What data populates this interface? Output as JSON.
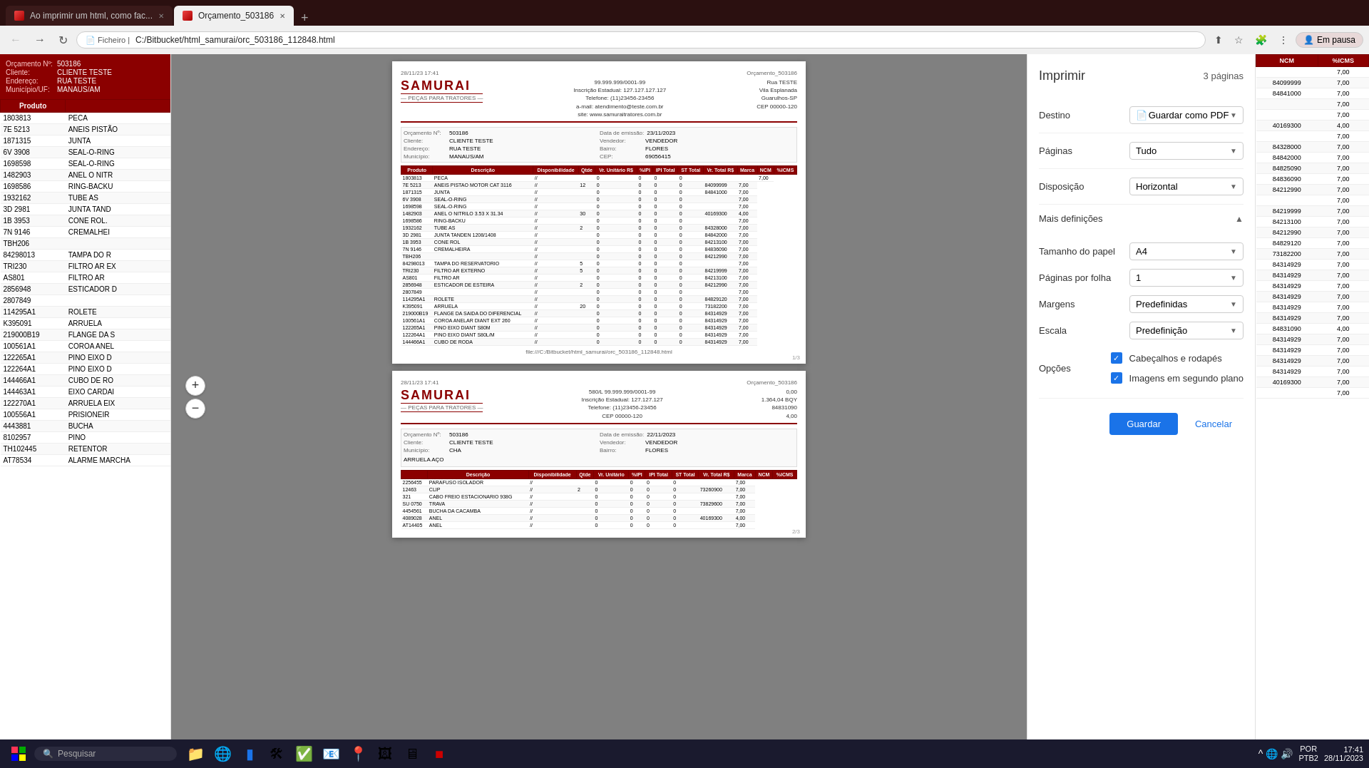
{
  "browser": {
    "tabs": [
      {
        "id": "tab1",
        "title": "Ao imprimir um html, como fac...",
        "active": false,
        "icon_color": "#e44"
      },
      {
        "id": "tab2",
        "title": "Orçamento_503186",
        "active": true,
        "icon_color": "#e44"
      }
    ],
    "address": {
      "protocol": "Ficheiro",
      "path": "C:/Bitbucket/html_samurai/orc_503186_112848.html"
    },
    "profile": "Em pausa"
  },
  "document": {
    "order_number": "503186",
    "client": "CLIENTE TESTE",
    "address": "RUA TESTE",
    "city": "MANAUS/AM",
    "labels": {
      "order": "Orçamento Nº:",
      "client": "Cliente:",
      "address": "Endereço:",
      "city": "Município/UF:"
    }
  },
  "left_table": {
    "headers": [
      "Produto",
      ""
    ],
    "rows": [
      [
        "1803813",
        "PECA"
      ],
      [
        "7E 5213",
        "ANEIS PISTÃO"
      ],
      [
        "1871315",
        "JUNTA"
      ],
      [
        "6V 3908",
        "SEAL-O-RING"
      ],
      [
        "1698598",
        "SEAL-O-RING"
      ],
      [
        "1482903",
        "ANEL O NITR"
      ],
      [
        "1698586",
        "RING-BACKU"
      ],
      [
        "1932162",
        "TUBE AS"
      ],
      [
        "3D 2981",
        "JUNTA TAND"
      ],
      [
        "1B 3953",
        "CONE ROL."
      ],
      [
        "7N 9146",
        "CREMALHEI"
      ],
      [
        "TBH206",
        ""
      ],
      [
        "84298013",
        "TAMPA DO R"
      ],
      [
        "TRI230",
        "FILTRO AR EX"
      ],
      [
        "AS801",
        "FILTRO AR"
      ],
      [
        "2856948",
        "ESTICADOR D"
      ],
      [
        "2807849",
        ""
      ],
      [
        "114295A1",
        "ROLETE"
      ],
      [
        "K395091",
        "ARRUELA"
      ],
      [
        "219000B19",
        "FLANGE DA S"
      ],
      [
        "100561A1",
        "COROA ANEL"
      ],
      [
        "122265A1",
        "PINO EIXO D"
      ],
      [
        "122264A1",
        "PINO EIXO D"
      ],
      [
        "144466A1",
        "CUBO DE RO"
      ],
      [
        "144463A1",
        "EIXO CARDAI"
      ],
      [
        "122270A1",
        "ARRUELA EIX"
      ],
      [
        "100556A1",
        "PRISIONEIR"
      ],
      [
        "4443881",
        "BUCHA"
      ],
      [
        "8102957",
        "PINO"
      ],
      [
        "TH102445",
        "RETENTOR"
      ],
      [
        "AT78534",
        "ALARME MARCHA"
      ]
    ]
  },
  "far_right_table": {
    "headers": [
      "NCM",
      "%ICMS"
    ],
    "rows": [
      [
        "",
        "7,00"
      ],
      [
        "84099999",
        "7,00"
      ],
      [
        "84841000",
        "7,00"
      ],
      [
        "",
        "7,00"
      ],
      [
        "",
        "7,00"
      ],
      [
        "40169300",
        "4,00"
      ],
      [
        "",
        "7,00"
      ],
      [
        "84328000",
        "7,00"
      ],
      [
        "84842000",
        "7,00"
      ],
      [
        "84825090",
        "7,00"
      ],
      [
        "84836090",
        "7,00"
      ],
      [
        "84212990",
        "7,00"
      ],
      [
        "",
        "7,00"
      ],
      [
        "84219999",
        "7,00"
      ],
      [
        "84213100",
        "7,00"
      ],
      [
        "84212990",
        "7,00"
      ],
      [
        "84829120",
        "7,00"
      ],
      [
        "73182200",
        "7,00"
      ],
      [
        "84314929",
        "7,00"
      ],
      [
        "84314929",
        "7,00"
      ],
      [
        "84314929",
        "7,00"
      ],
      [
        "84314929",
        "7,00"
      ],
      [
        "84314929",
        "7,00"
      ],
      [
        "84314929",
        "7,00"
      ],
      [
        "84831090",
        "4,00"
      ],
      [
        "84314929",
        "7,00"
      ],
      [
        "84314929",
        "7,00"
      ],
      [
        "84314929",
        "7,00"
      ],
      [
        "84314929",
        "7,00"
      ],
      [
        "40169300",
        "7,00"
      ],
      [
        "",
        "7,00"
      ]
    ]
  },
  "print_dialog": {
    "title": "Imprimir",
    "pages_info": "3 páginas",
    "fields": {
      "destino_label": "Destino",
      "destino_value": "Guardar como PDF",
      "paginas_label": "Páginas",
      "paginas_value": "Tudo",
      "disposicao_label": "Disposição",
      "disposicao_value": "Horizontal",
      "mais_definicoes_label": "Mais definições",
      "tamanho_label": "Tamanho do papel",
      "tamanho_value": "A4",
      "paginas_folha_label": "Páginas por folha",
      "paginas_folha_value": "1",
      "margens_label": "Margens",
      "margens_value": "Predefinidas",
      "escala_label": "Escala",
      "escala_value": "Predefinição",
      "opcoes_label": "Opções",
      "check1": "Cabeçalhos e rodapés",
      "check2": "Imagens em segundo plano"
    },
    "buttons": {
      "guardar": "Guardar",
      "cancelar": "Cancelar"
    }
  },
  "page1": {
    "timestamp": "28/11/23  17:41",
    "doc_title": "Orçamento_503186",
    "order": "503186",
    "client": "CLIENTE TESTE",
    "address": "RUA TESTE",
    "city": "MANAUS/AM",
    "date": "23/11/2023",
    "vendor": "VENDEDOR",
    "bairro": "FLORES",
    "cep": "69056415",
    "cnpj": "99.999.999/0001-99",
    "ie": "Inscrição Estadual: 127.127.127.127",
    "phone": "Telefone: (11)23456-23456",
    "email": "a-mail: atendimento@teste.com.br",
    "website": "site: www.samuraitratores.com.br",
    "rua": "Rua TESTE",
    "vila": "Vila Esplanada",
    "guarulhos": "Guarulhos-SP",
    "cep_company": "CEP 00000-120",
    "page_num": "1/3",
    "mini_rows": [
      [
        "1803813",
        "PECA",
        "//",
        "",
        0,
        0,
        0,
        0,
        "",
        "",
        "7,00"
      ],
      [
        "7E 5213",
        "ANEIS PISTAO MOTOR CAT 3116",
        "//",
        12,
        0,
        0,
        0,
        0,
        "84099999",
        "7,00"
      ],
      [
        "1871315",
        "JUNTA",
        "//",
        "",
        0,
        0,
        0,
        0,
        "84841000",
        "7,00"
      ],
      [
        "6V 3908",
        "SEAL-O-RING",
        "//",
        "",
        0,
        0,
        0,
        0,
        "",
        "7,00"
      ],
      [
        "1698598",
        "SEAL-O-RING",
        "//",
        "",
        0,
        0,
        0,
        0,
        "",
        "7,00"
      ],
      [
        "1482903",
        "ANEL O NITRILO 3.53 X 31.34",
        "//",
        30,
        0,
        0,
        0,
        0,
        "40169300",
        "4,00"
      ],
      [
        "1698586",
        "RING-BACKU",
        "//",
        "",
        0,
        0,
        0,
        0,
        "",
        "7,00"
      ],
      [
        "1932162",
        "TUBE AS",
        "//",
        2,
        0,
        0,
        0,
        0,
        "84328000",
        "7,00"
      ],
      [
        "3D 2981",
        "JUNTA TANDEN 1208/1408",
        "//",
        "",
        0,
        0,
        0,
        0,
        "84842000",
        "7,00"
      ],
      [
        "1B 3953",
        "CONE ROL",
        "//",
        "",
        0,
        0,
        0,
        0,
        "84213100",
        "7,00"
      ],
      [
        "7N 9146",
        "CREMALHEIRA",
        "//",
        "",
        0,
        0,
        0,
        0,
        "84836090",
        "7,00"
      ],
      [
        "TBH206",
        "",
        "//",
        "",
        0,
        0,
        0,
        0,
        "84212990",
        "7,00"
      ],
      [
        "84298013",
        "TAMPA DO RESERVATORIO",
        "//",
        5,
        0,
        0,
        0,
        0,
        "",
        "7,00"
      ],
      [
        "TRI230",
        "FILTRO AR EXTERNO",
        "//",
        5,
        0,
        0,
        0,
        0,
        "84219999",
        "7,00"
      ],
      [
        "AS801",
        "FILTRO AR",
        "//",
        "",
        0,
        0,
        0,
        0,
        "84213100",
        "7,00"
      ],
      [
        "2856948",
        "ESTICADOR DE ESTEIRA",
        "//",
        2,
        0,
        0,
        0,
        0,
        "84212990",
        "7,00"
      ],
      [
        "2807849",
        "",
        "//",
        "",
        0,
        0,
        0,
        0,
        "",
        "7,00"
      ],
      [
        "114295A1",
        "ROLETE",
        "//",
        "",
        0,
        0,
        0,
        0,
        "84829120",
        "7,00"
      ],
      [
        "K395091",
        "ARRUELA",
        "//",
        20,
        0,
        0,
        0,
        0,
        "73182200",
        "7,00"
      ],
      [
        "219000B19",
        "FLANGE DA SAIDA DO DIFERENCIAL",
        "//",
        "",
        0,
        0,
        0,
        0,
        "84314929",
        "7,00"
      ],
      [
        "100561A1",
        "COROA ANELAR DIANT EXT 260",
        "//",
        "",
        0,
        0,
        0,
        0,
        "84314929",
        "7,00"
      ],
      [
        "122265A1",
        "PINO EIXO DIANT S80M",
        "//",
        "",
        0,
        0,
        0,
        0,
        "84314929",
        "7,00"
      ],
      [
        "122264A1",
        "PINO EIXO DIANT S80L/M",
        "//",
        "",
        0,
        0,
        0,
        0,
        "84314929",
        "7,00"
      ],
      [
        "144466A1",
        "CUBO DE RODA",
        "//",
        "",
        0,
        0,
        0,
        0,
        "84314929",
        "7,00"
      ]
    ]
  },
  "page2": {
    "timestamp": "28/11/23  17:41",
    "doc_title": "Orçamento_503186",
    "page_num": "2/3",
    "mini_rows": [
      [
        "2256455",
        "PARAFUSO ISOLADOR",
        "//",
        "",
        0,
        0,
        0,
        0,
        "",
        "7,00"
      ],
      [
        "12463",
        "CLIP",
        "//",
        2,
        0,
        0,
        0,
        0,
        "73260900",
        "7,00"
      ],
      [
        "321",
        "CABO FREIO ESTACIONARIO 938G",
        "//",
        "",
        0,
        0,
        0,
        0,
        "",
        "7,00"
      ],
      [
        "SU 0750",
        "TRAVA",
        "//",
        "",
        0,
        0,
        0,
        0,
        "73829600",
        "7,00"
      ],
      [
        "4454561",
        "BUCHA DA CACAMBA",
        "//",
        "",
        0,
        0,
        0,
        0,
        "",
        "7,00"
      ],
      [
        "4089028",
        "ANEL",
        "//",
        "",
        0,
        0,
        0,
        0,
        "40169300",
        "4,00"
      ],
      [
        "AT14405",
        "ANEL",
        "//",
        "",
        0,
        0,
        0,
        0,
        "",
        "7,00"
      ]
    ]
  },
  "taskbar": {
    "search_placeholder": "Pesquisar",
    "time": "17:41",
    "date": "28/11/2023",
    "lang": "POR\nPTB2"
  }
}
